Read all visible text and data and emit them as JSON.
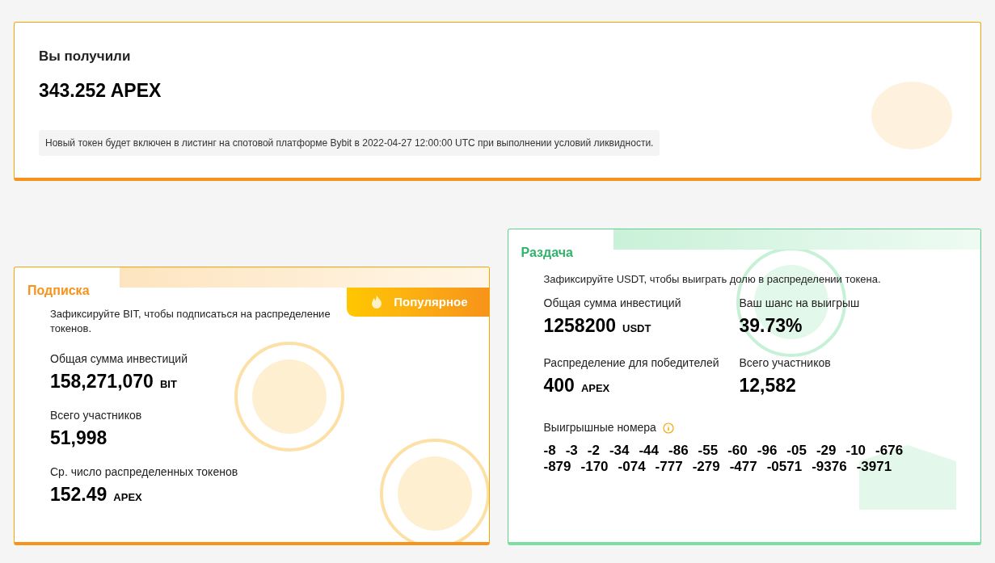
{
  "received": {
    "label": "Вы получили",
    "amount": "343.252 APEX",
    "note": "Новый токен будет включен в листинг на спотовой платформе Bybit в 2022-04-27 12:00:00 UTC при выполнении условий ликвидности."
  },
  "subscription": {
    "title": "Подписка",
    "badge": "Популярное",
    "description": "Зафиксируйте BIT, чтобы подписаться на распределение токенов.",
    "stats": [
      {
        "label": "Общая сумма инвестиций",
        "value": "158,271,070",
        "unit": "BIT"
      },
      {
        "label": "Всего участников",
        "value": "51,998"
      },
      {
        "label": "Ср. число распределенных токенов",
        "value": "152.49",
        "unit": "APEX"
      }
    ]
  },
  "airdrop": {
    "title": "Раздача",
    "description": "Зафиксируйте USDT, чтобы выиграть долю в распределении токена.",
    "stats": [
      {
        "label": "Общая сумма инвестиций",
        "value": "1258200",
        "unit": "USDT"
      },
      {
        "label": "Ваш шанс на выигрыш",
        "value": "39.73%"
      },
      {
        "label": "Распределение для победителей",
        "value": "400",
        "unit": "APEX"
      },
      {
        "label": "Всего участников",
        "value": "12,582"
      }
    ],
    "winning_numbers": {
      "label": "Выигрышные номера",
      "numbers": [
        "-8",
        "-3",
        "-2",
        "-34",
        "-44",
        "-86",
        "-55",
        "-60",
        "-96",
        "-05",
        "-29",
        "-10",
        "-676",
        "-879",
        "-170",
        "-074",
        "-777",
        "-279",
        "-477",
        "-0571",
        "-9376",
        "-3971"
      ]
    }
  }
}
